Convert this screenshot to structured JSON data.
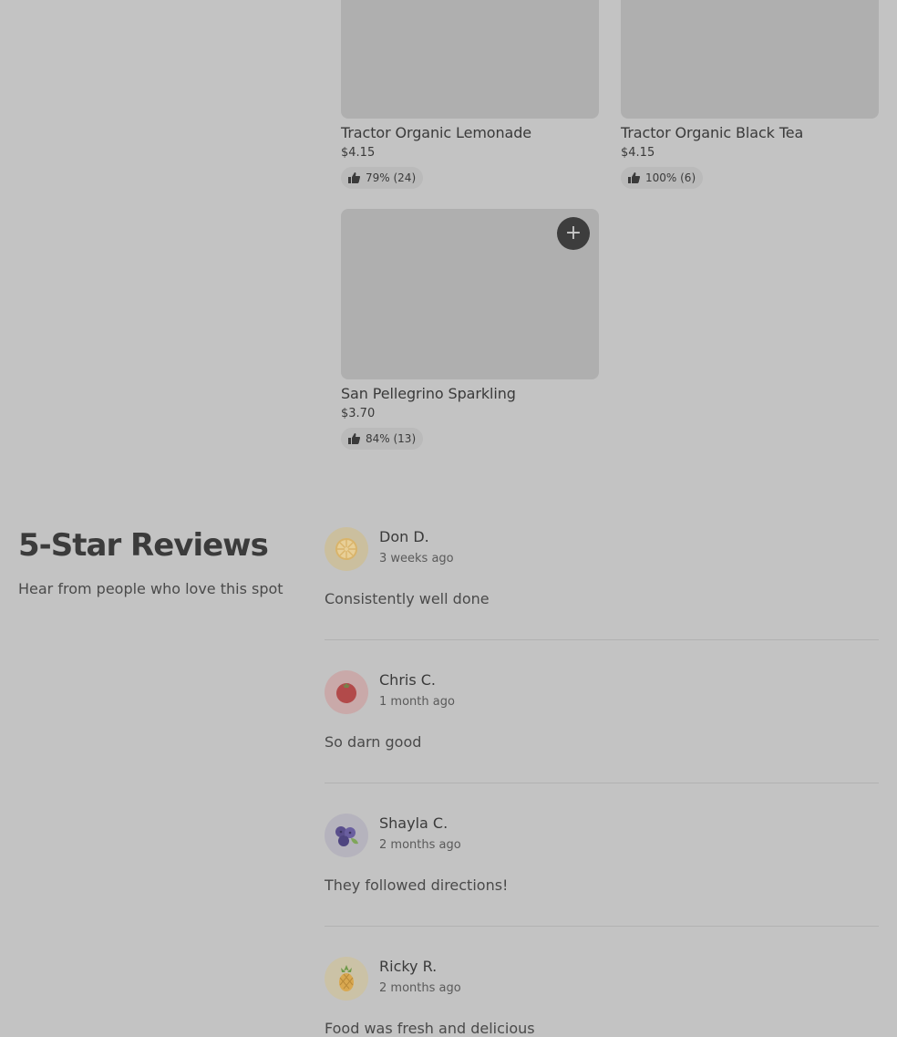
{
  "products": [
    {
      "name": "Tractor Organic Lemonade",
      "price": "$4.15",
      "rating": "79% (24)"
    },
    {
      "name": "Tractor Organic Black Tea",
      "price": "$4.15",
      "rating": "100% (6)"
    },
    {
      "name": "San Pellegrino Sparkling",
      "price": "$3.70",
      "rating": "84% (13)",
      "add_label": "+"
    }
  ],
  "reviews_section": {
    "title": "5-Star Reviews",
    "subtitle": "Hear from people who love this spot"
  },
  "reviews": [
    {
      "author": "Don D.",
      "time": "3 weeks ago",
      "text": "Consistently well done",
      "avatar_icon": "lemon-slice-icon",
      "avatar_bg": "#cbbf9e"
    },
    {
      "author": "Chris C.",
      "time": "1 month ago",
      "text": "So darn good",
      "avatar_icon": "tomato-icon",
      "avatar_bg": "#c9a9a9"
    },
    {
      "author": "Shayla C.",
      "time": "2 months ago",
      "text": "They followed directions!",
      "avatar_icon": "blueberries-icon",
      "avatar_bg": "#b5b3bd"
    },
    {
      "author": "Ricky R.",
      "time": "2 months ago",
      "text": "Food was fresh and delicious",
      "avatar_icon": "pineapple-icon",
      "avatar_bg": "#cbc2a6"
    }
  ]
}
